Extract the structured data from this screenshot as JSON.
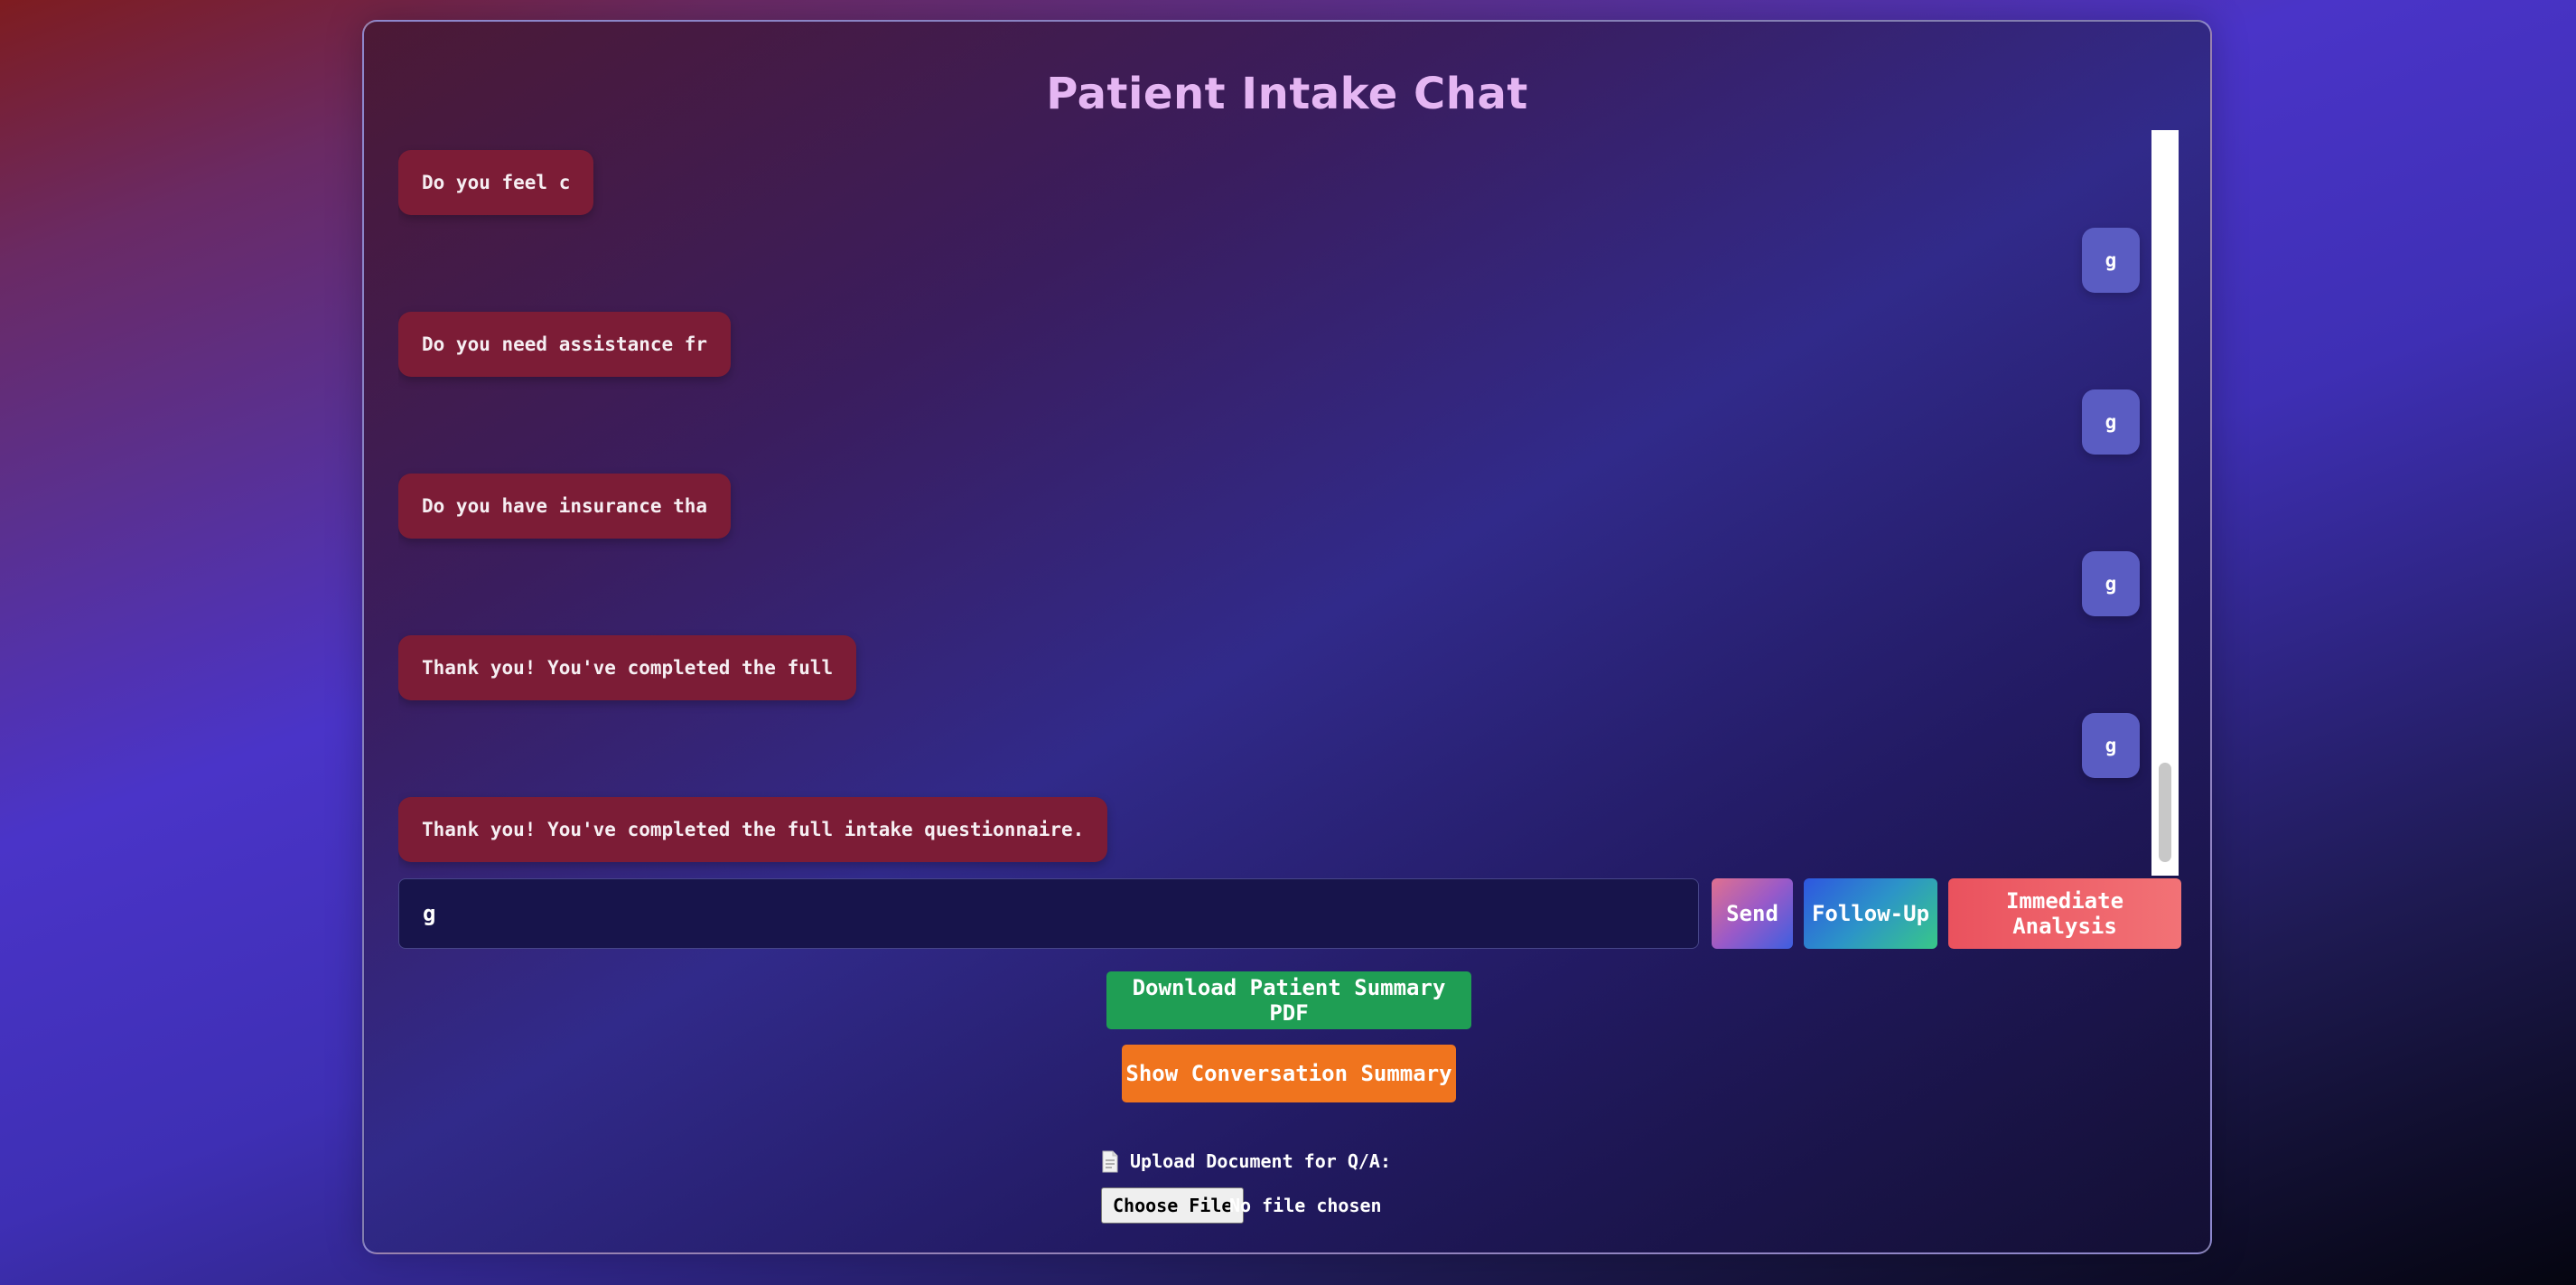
{
  "app": {
    "title": "Patient Intake Chat"
  },
  "chat": {
    "messages": [
      {
        "sender": "bot",
        "text": "Do you feel c"
      },
      {
        "sender": "user",
        "text": "g"
      },
      {
        "sender": "bot",
        "text": "Do you need assistance fr"
      },
      {
        "sender": "user",
        "text": "g"
      },
      {
        "sender": "bot",
        "text": "Do you have insurance tha"
      },
      {
        "sender": "user",
        "text": "g"
      },
      {
        "sender": "bot",
        "text": "Thank you! You've completed the full"
      },
      {
        "sender": "user",
        "text": "g"
      },
      {
        "sender": "bot",
        "text": "Thank you! You've completed the full intake questionnaire."
      }
    ]
  },
  "input": {
    "value": "g"
  },
  "buttons": {
    "send": "Send",
    "follow_up": "Follow-Up",
    "immediate_analysis": "Immediate Analysis",
    "download_pdf": "Download Patient Summary PDF",
    "show_summary": "Show Conversation Summary"
  },
  "upload": {
    "icon": "document-icon",
    "label": "Upload Document for Q/A:",
    "choose_file": "Choose File",
    "status": "No file chosen"
  },
  "colors": {
    "title": "#e5b6f3",
    "bot_bubble": "#7c1c36",
    "user_bubble": "#5a5cc2",
    "pdf_button": "#1f9e54",
    "summary_button": "#f0741e",
    "analysis_button": "#ea525e"
  }
}
